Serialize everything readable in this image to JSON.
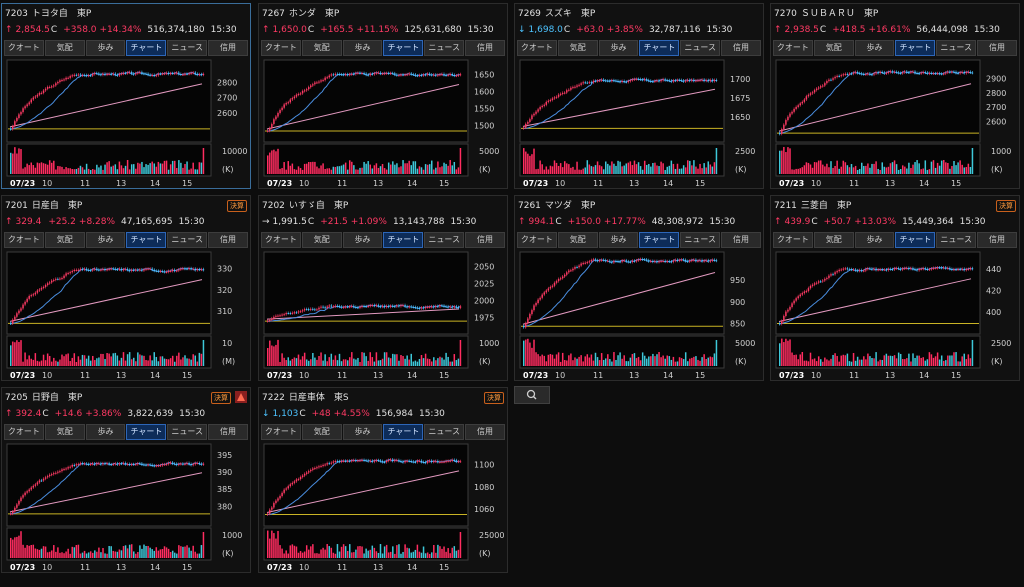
{
  "tab_labels": [
    "クオート",
    "気配",
    "歩み",
    "チャート",
    "ニュース",
    "信用"
  ],
  "active_tab": "チャート",
  "colors": {
    "up": "#ff3a64",
    "down": "#4dc3ff",
    "volume_up": "#ff2d60",
    "volume_down": "#3ec8d9",
    "ma_short": "#d8d8d8",
    "ma_mid": "#4a8ee0",
    "ma_long": "#e39ac0",
    "base_line": "#c9b325"
  },
  "toolbar": {
    "search_icon": "search-icon"
  },
  "panels": [
    {
      "code": "7203",
      "name": "トヨタ自",
      "market": "東P",
      "arrow": "↑",
      "price": "2,854.5",
      "flag": "C",
      "change": "+358.0",
      "pct": "+14.34%",
      "volume": "516,374,180",
      "time": "15:30",
      "dir": "up",
      "badge": "",
      "warn": false,
      "y_ticks": [
        "2800",
        "2700",
        "2600"
      ],
      "vol_ticks": [
        "10000",
        "(K)"
      ],
      "x_ticks": [
        "07/23",
        "10",
        "11",
        "13",
        "14",
        "15"
      ],
      "chart_data": {
        "type": "candlestick",
        "open": 2496.5,
        "close": 2854.5,
        "ylim": [
          2450,
          2920
        ]
      }
    },
    {
      "code": "7267",
      "name": "ホンダ",
      "market": "東P",
      "arrow": "↑",
      "price": "1,650.0",
      "flag": "C",
      "change": "+165.5",
      "pct": "+11.15%",
      "volume": "125,631,680",
      "time": "15:30",
      "dir": "up",
      "badge": "",
      "warn": false,
      "y_ticks": [
        "1650",
        "1600",
        "1550",
        "1500"
      ],
      "vol_ticks": [
        "5000",
        "(K)"
      ],
      "x_ticks": [
        "07/23",
        "10",
        "11",
        "13",
        "14",
        "15"
      ],
      "chart_data": {
        "type": "candlestick",
        "open": 1484.5,
        "close": 1650.0,
        "ylim": [
          1470,
          1680
        ]
      }
    },
    {
      "code": "7269",
      "name": "スズキ",
      "market": "東P",
      "arrow": "↓",
      "price": "1,698.0",
      "flag": "C",
      "change": "+63.0",
      "pct": "+3.85%",
      "volume": "32,787,116",
      "time": "15:30",
      "dir": "dn",
      "badge": "",
      "warn": false,
      "y_ticks": [
        "1700",
        "1675",
        "1650"
      ],
      "vol_ticks": [
        "2500",
        "(K)"
      ],
      "x_ticks": [
        "07/23",
        "10",
        "11",
        "13",
        "14",
        "15"
      ],
      "chart_data": {
        "type": "candlestick",
        "open": 1635.0,
        "close": 1698.0,
        "ylim": [
          1625,
          1720
        ]
      }
    },
    {
      "code": "7270",
      "name": "ＳＵＢＡＲＵ",
      "market": "東P",
      "arrow": "↑",
      "price": "2,938.5",
      "flag": "C",
      "change": "+418.5",
      "pct": "+16.61%",
      "volume": "56,444,098",
      "time": "15:30",
      "dir": "up",
      "badge": "",
      "warn": false,
      "y_ticks": [
        "2900",
        "2800",
        "2700",
        "2600"
      ],
      "vol_ticks": [
        "1000",
        "(K)"
      ],
      "x_ticks": [
        "07/23",
        "10",
        "11",
        "13",
        "14",
        "15"
      ],
      "chart_data": {
        "type": "candlestick",
        "open": 2520.0,
        "close": 2938.5,
        "ylim": [
          2500,
          3000
        ]
      }
    },
    {
      "code": "7201",
      "name": "日産自",
      "market": "東P",
      "arrow": "↑",
      "price": "329.4",
      "flag": "",
      "change": "+25.2",
      "pct": "+8.28%",
      "volume": "47,165,695",
      "time": "15:30",
      "dir": "up",
      "badge": "決算",
      "warn": false,
      "y_ticks": [
        "330",
        "320",
        "310"
      ],
      "vol_ticks": [
        "10",
        "(M)"
      ],
      "x_ticks": [
        "07/23",
        "10",
        "11",
        "13",
        "14",
        "15"
      ],
      "chart_data": {
        "type": "candlestick",
        "open": 304.2,
        "close": 329.4,
        "ylim": [
          302,
          336
        ]
      }
    },
    {
      "code": "7202",
      "name": "いすゞ自",
      "market": "東P",
      "arrow": "→",
      "price": "1,991.5",
      "flag": "C",
      "change": "+21.5",
      "pct": "+1.09%",
      "volume": "13,143,788",
      "time": "15:30",
      "dir": "wt",
      "badge": "",
      "warn": false,
      "y_ticks": [
        "2050",
        "2025",
        "2000",
        "1975"
      ],
      "vol_ticks": [
        "1000",
        "(K)"
      ],
      "x_ticks": [
        "07/23",
        "10",
        "11",
        "13",
        "14",
        "15"
      ],
      "chart_data": {
        "type": "candlestick",
        "open": 1970.0,
        "close": 1991.5,
        "ylim": [
          1960,
          2065
        ]
      }
    },
    {
      "code": "7261",
      "name": "マツダ",
      "market": "東P",
      "arrow": "↑",
      "price": "994.1",
      "flag": "C",
      "change": "+150.0",
      "pct": "+17.77%",
      "volume": "48,308,972",
      "time": "15:30",
      "dir": "up",
      "badge": "",
      "warn": false,
      "y_ticks": [
        "950",
        "900",
        "850"
      ],
      "vol_ticks": [
        "5000",
        "(K)"
      ],
      "x_ticks": [
        "07/23",
        "10",
        "11",
        "13",
        "14",
        "15"
      ],
      "chart_data": {
        "type": "candlestick",
        "open": 844.1,
        "close": 994.1,
        "ylim": [
          840,
          1005
        ]
      }
    },
    {
      "code": "7211",
      "name": "三菱自",
      "market": "東P",
      "arrow": "↑",
      "price": "439.9",
      "flag": "C",
      "change": "+50.7",
      "pct": "+13.03%",
      "volume": "15,449,364",
      "time": "15:30",
      "dir": "up",
      "badge": "決算",
      "warn": false,
      "y_ticks": [
        "440",
        "420",
        "400"
      ],
      "vol_ticks": [
        "2500",
        "(K)"
      ],
      "x_ticks": [
        "07/23",
        "10",
        "11",
        "13",
        "14",
        "15"
      ],
      "chart_data": {
        "type": "candlestick",
        "open": 389.2,
        "close": 439.9,
        "ylim": [
          385,
          452
        ]
      }
    },
    {
      "code": "7205",
      "name": "日野自",
      "market": "東P",
      "arrow": "↑",
      "price": "392.4",
      "flag": "C",
      "change": "+14.6",
      "pct": "+3.86%",
      "volume": "3,822,639",
      "time": "15:30",
      "dir": "up",
      "badge": "決算",
      "warn": true,
      "y_ticks": [
        "395",
        "390",
        "385",
        "380"
      ],
      "vol_ticks": [
        "1000",
        "(K)"
      ],
      "x_ticks": [
        "07/23",
        "10",
        "11",
        "13",
        "14",
        "15"
      ],
      "chart_data": {
        "type": "candlestick",
        "open": 377.8,
        "close": 392.4,
        "ylim": [
          376,
          397
        ]
      }
    },
    {
      "code": "7222",
      "name": "日産車体",
      "market": "東S",
      "arrow": "↓",
      "price": "1,103",
      "flag": "C",
      "change": "+48",
      "pct": "+4.55%",
      "volume": "156,984",
      "time": "15:30",
      "dir": "dn",
      "badge": "決算",
      "warn": false,
      "y_ticks": [
        "1100",
        "1080",
        "1060"
      ],
      "vol_ticks": [
        "25000",
        "(K)"
      ],
      "x_ticks": [
        "07/23",
        "10",
        "11",
        "13",
        "14",
        "15"
      ],
      "chart_data": {
        "type": "candlestick",
        "open": 1055,
        "close": 1103,
        "ylim": [
          1050,
          1115
        ]
      }
    }
  ]
}
